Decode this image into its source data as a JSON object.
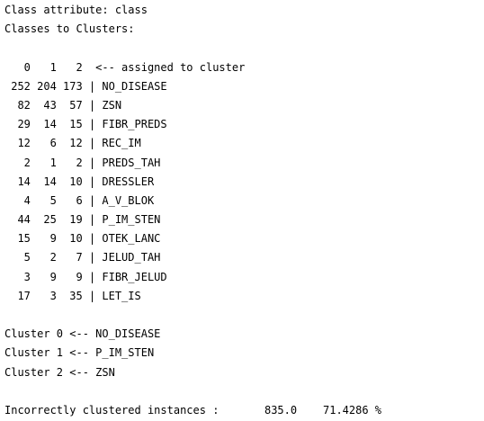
{
  "output": {
    "lines": [
      "Class attribute: class",
      "Classes to Clusters:",
      "",
      "   0   1   2  <-- assigned to cluster",
      " 252 204 173 | NO_DISEASE",
      "  82  43  57 | ZSN",
      "  29  14  15 | FIBR_PREDS",
      "  12   6  12 | REC_IM",
      "   2   1   2 | PREDS_TAH",
      "  14  14  10 | DRESSLER",
      "   4   5   6 | A_V_BLOK",
      "  44  25  19 | P_IM_STEN",
      "  15   9  10 | OTEK_LANC",
      "   5   2   7 | JELUD_TAH",
      "   3   9   9 | FIBR_JELUD",
      "  17   3  35 | LET_IS",
      "",
      "Cluster 0 <-- NO_DISEASE",
      "Cluster 1 <-- P_IM_STEN",
      "Cluster 2 <-- ZSN",
      "",
      "Incorrectly clustered instances :\t835.0\t 71.4286 %"
    ]
  }
}
